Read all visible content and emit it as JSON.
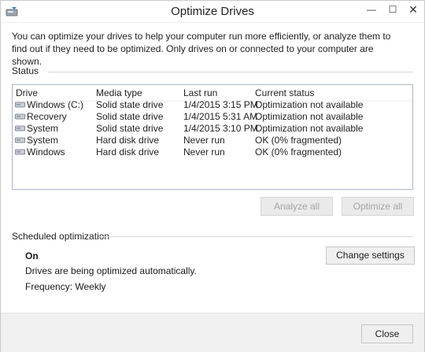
{
  "window": {
    "title": "Optimize Drives",
    "minimize_glyph": "—",
    "maximize_glyph": "☐",
    "close_glyph": "✕"
  },
  "intro": "You can optimize your drives to help your computer run more efficiently, or analyze them to find out if they need to be optimized. Only drives on or connected to your computer are shown.",
  "status": {
    "label": "Status",
    "columns": [
      "Drive",
      "Media type",
      "Last run",
      "Current status"
    ],
    "rows": [
      {
        "drive": "Windows (C:)",
        "media": "Solid state drive",
        "last_run": "1/4/2015 3:15 PM",
        "status": "Optimization not available"
      },
      {
        "drive": "Recovery",
        "media": "Solid state drive",
        "last_run": "1/4/2015 5:31 AM",
        "status": "Optimization not available"
      },
      {
        "drive": "System",
        "media": "Solid state drive",
        "last_run": "1/4/2015 3:10 PM",
        "status": "Optimization not available"
      },
      {
        "drive": "System",
        "media": "Hard disk drive",
        "last_run": "Never run",
        "status": "OK (0% fragmented)"
      },
      {
        "drive": "Windows",
        "media": "Hard disk drive",
        "last_run": "Never run",
        "status": "OK (0% fragmented)"
      }
    ],
    "analyze_all": "Analyze all",
    "optimize_all": "Optimize all"
  },
  "scheduled": {
    "label": "Scheduled optimization",
    "state": "On",
    "description": "Drives are being optimized automatically.",
    "frequency": "Frequency: Weekly",
    "change_settings": "Change settings"
  },
  "footer": {
    "close_label": "Close"
  },
  "icons": {
    "app": "optimize-drives-icon",
    "drive": "hard-drive-icon"
  },
  "colors": {
    "list_border": "#aab6c6",
    "footer_bg": "#f0f0f0",
    "disabled_text": "#a4a4a4"
  }
}
